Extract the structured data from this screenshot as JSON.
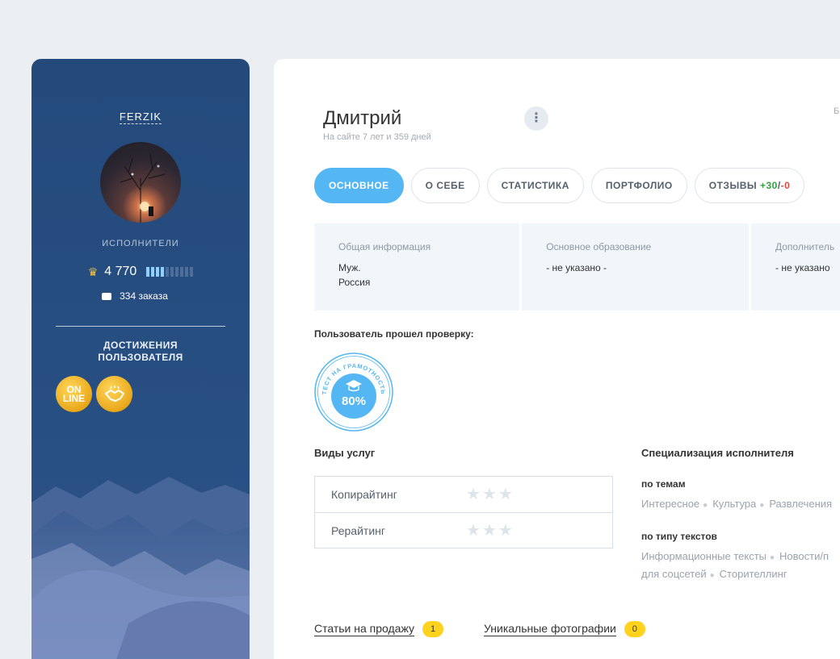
{
  "sidebar": {
    "username": "FERZIK",
    "role": "ИСПОЛНИТЕЛИ",
    "rating": "4 770",
    "rating_level": 0.4,
    "orders": "334 заказа",
    "achievements_title": "ДОСТИЖЕНИЯ ПОЛЬЗОВАТЕЛЯ",
    "badges": [
      {
        "text": "ON LINE"
      },
      {
        "icon": "handshake-icon"
      }
    ]
  },
  "profile": {
    "name": "Дмитрий",
    "since": "На сайте 7 лет и 359 дней",
    "edge_letter": "Б"
  },
  "tabs": [
    {
      "label": "ОСНОВНОЕ",
      "active": true
    },
    {
      "label": "О СЕБЕ"
    },
    {
      "label": "СТАТИСТИКА"
    },
    {
      "label": "ПОРТФОЛИО"
    },
    {
      "label": "ОТЗЫВЫ",
      "pos": "+30",
      "slash": "/",
      "neg": "-0"
    }
  ],
  "info": [
    {
      "label": "Общая информация",
      "lines": [
        "Муж.",
        "Россия"
      ]
    },
    {
      "label": "Основное образование",
      "lines": [
        "- не указано -"
      ]
    },
    {
      "label": "Дополнитель",
      "lines": [
        "- не указано"
      ]
    }
  ],
  "verification": {
    "title": "Пользователь прошел проверку:",
    "stamp_text": "ТЕСТ НА ГРАМОТНОСТЬ",
    "percent": "80%"
  },
  "services": {
    "title": "Виды услуг",
    "items": [
      {
        "name": "Копирайтинг",
        "stars": 0
      },
      {
        "name": "Рерайтинг",
        "stars": 0
      }
    ]
  },
  "specialization": {
    "title": "Специализация исполнителя",
    "by_topic_title": "по темам",
    "topics": [
      "Интересное",
      "Культура",
      "Развлечения"
    ],
    "by_type_title": "по типу текстов",
    "types_line1": [
      "Информационные тексты",
      "Новости/п"
    ],
    "types_line2": [
      "для соцсетей",
      "Сторителлинг"
    ]
  },
  "bottom": {
    "articles_label": "Статьи на продажу",
    "articles_count": "1",
    "photos_label": "Уникальные фотографии",
    "photos_count": "0"
  },
  "colors": {
    "accent": "#54b7f3",
    "sidebar": "#244a7c",
    "badge_gold": "#e9a81b",
    "count_yellow": "#ffd21e"
  }
}
